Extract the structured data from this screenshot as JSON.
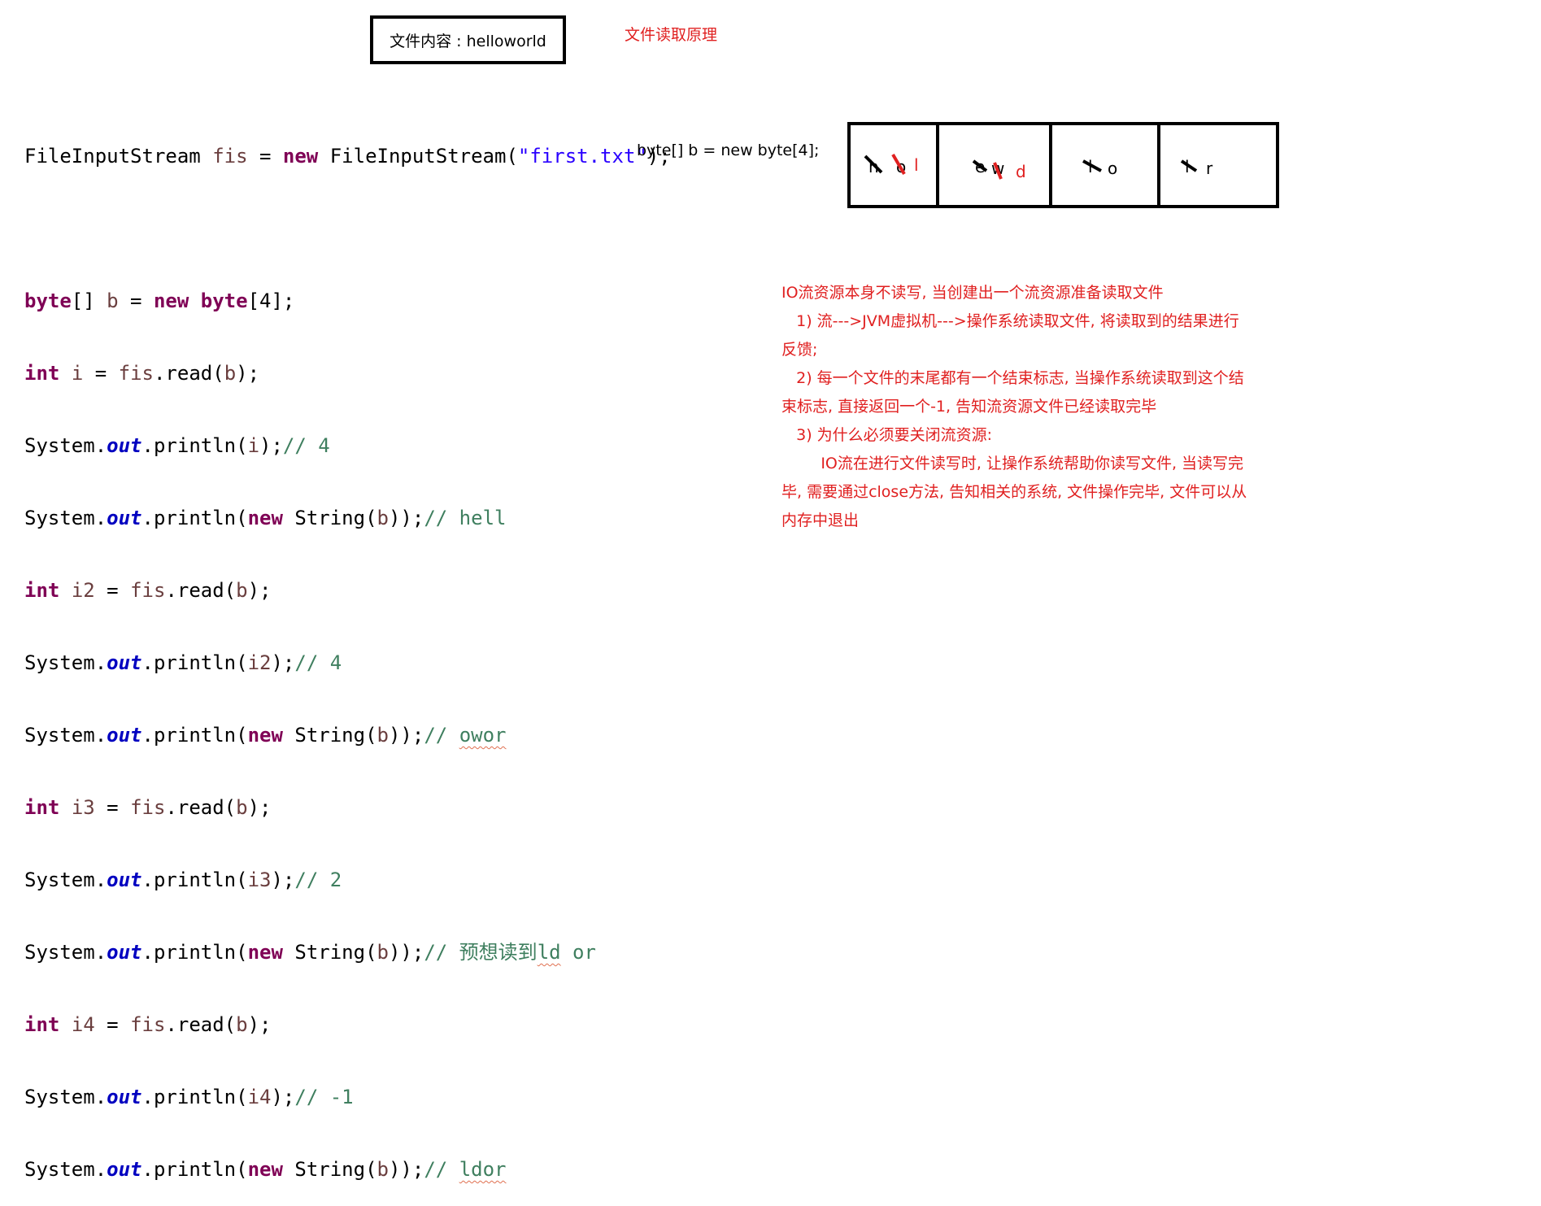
{
  "file_box": "文件内容 : helloworld",
  "heading": "文件读取原理",
  "array_label": "byte[] b = new byte[4];",
  "array_cells": [
    {
      "crossed": [
        "h",
        "o"
      ],
      "current": "l"
    },
    {
      "crossed": [
        "e",
        "w"
      ],
      "current": "d"
    },
    {
      "crossed": [
        "l"
      ],
      "current": "o"
    },
    {
      "crossed": [
        "l"
      ],
      "current": "r"
    }
  ],
  "code": {
    "l1": {
      "a": "FileInputStream ",
      "b": "fis",
      "c": " = ",
      "d": "new",
      "e": " FileInputStream(",
      "f": "\"first.txt\"",
      "g": ");"
    },
    "l2": {
      "a": "byte",
      "b": "[] ",
      "c": "b",
      "d": " = ",
      "e": "new",
      "f": " ",
      "g": "byte",
      "h": "[4];"
    },
    "l3": {
      "a": "int",
      "b": " ",
      "c": "i",
      "d": " = ",
      "e": "fis",
      "f": ".read(",
      "g": "b",
      "h": ");"
    },
    "l4": {
      "a": "System.",
      "b": "out",
      "c": ".println(",
      "d": "i",
      "e": ");",
      "f": "// 4"
    },
    "l5": {
      "a": "System.",
      "b": "out",
      "c": ".println(",
      "d": "new",
      "e": " String(",
      "f": "b",
      "g": "));",
      "h": "// hell"
    },
    "l6": {
      "a": "int",
      "b": " ",
      "c": "i2",
      "d": " = ",
      "e": "fis",
      "f": ".read(",
      "g": "b",
      "h": ");"
    },
    "l7": {
      "a": "System.",
      "b": "out",
      "c": ".println(",
      "d": "i2",
      "e": ");",
      "f": "// 4"
    },
    "l8": {
      "a": "System.",
      "b": "out",
      "c": ".println(",
      "d": "new",
      "e": " String(",
      "f": "b",
      "g": "));",
      "h": "// ",
      "i": "owor"
    },
    "l9": {
      "a": "int",
      "b": " ",
      "c": "i3",
      "d": " = ",
      "e": "fis",
      "f": ".read(",
      "g": "b",
      "h": ");"
    },
    "l10": {
      "a": "System.",
      "b": "out",
      "c": ".println(",
      "d": "i3",
      "e": ");",
      "f": "// 2"
    },
    "l11": {
      "a": "System.",
      "b": "out",
      "c": ".println(",
      "d": "new",
      "e": " String(",
      "f": "b",
      "g": "));",
      "h": "// 预想读到",
      "i": "ld",
      "j": " or"
    },
    "l12": {
      "a": "int",
      "b": " ",
      "c": "i4",
      "d": " = ",
      "e": "fis",
      "f": ".read(",
      "g": "b",
      "h": ");"
    },
    "l13": {
      "a": "System.",
      "b": "out",
      "c": ".println(",
      "d": "i4",
      "e": ");",
      "f": "// -1"
    },
    "l14": {
      "a": "System.",
      "b": "out",
      "c": ".println(",
      "d": "new",
      "e": " String(",
      "f": "b",
      "g": "));",
      "h": "// ",
      "i": "ldor"
    }
  },
  "notes": [
    "IO流资源本身不读写, 当创建出一个流资源准备读取文件",
    "   1) 流--->JVM虚拟机--->操作系统读取文件, 将读取到的结果进行反馈;",
    "   2) 每一个文件的末尾都有一个结束标志, 当操作系统读取到这个结束标志, 直接返回一个-1, 告知流资源文件已经读取完毕",
    "   3) 为什么必须要关闭流资源:",
    "        IO流在进行文件读写时, 让操作系统帮助你读写文件, 当读写完毕, 需要通过close方法, 告知相关的系统, 文件操作完毕, 文件可以从内存中退出"
  ]
}
